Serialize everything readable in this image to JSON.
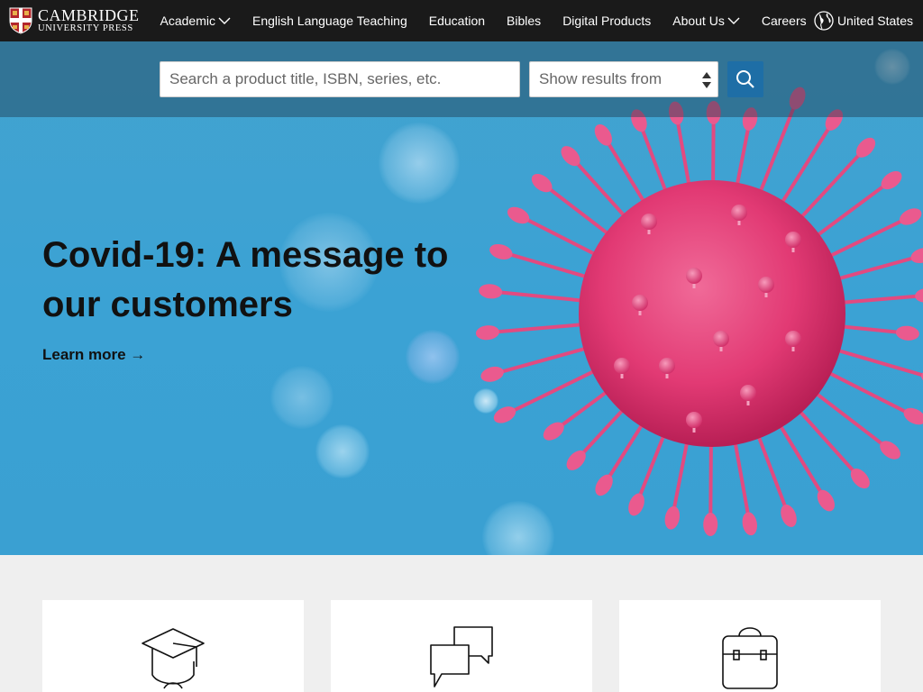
{
  "brand": {
    "line1": "CAMBRIDGE",
    "line2": "UNIVERSITY PRESS"
  },
  "nav": {
    "items": [
      {
        "label": "Academic",
        "dropdown": true
      },
      {
        "label": "English Language Teaching",
        "dropdown": false
      },
      {
        "label": "Education",
        "dropdown": false
      },
      {
        "label": "Bibles",
        "dropdown": false
      },
      {
        "label": "Digital Products",
        "dropdown": false
      },
      {
        "label": "About Us",
        "dropdown": true
      },
      {
        "label": "Careers",
        "dropdown": false
      }
    ],
    "region": "United States"
  },
  "search": {
    "placeholder": "Search a product title, ISBN, series, etc.",
    "filter_placeholder": "Show results from"
  },
  "hero": {
    "title": "Covid-19: A message to our customers",
    "cta": "Learn more →"
  },
  "cards": [
    {
      "icon": "graduation-cap-icon"
    },
    {
      "icon": "speech-bubbles-icon"
    },
    {
      "icon": "school-bag-icon"
    }
  ],
  "colors": {
    "nav_bg": "#1a1a1a",
    "hero_bg": "#3ba2d4",
    "accent": "#1e6ea6",
    "virus": "#e33d78"
  }
}
